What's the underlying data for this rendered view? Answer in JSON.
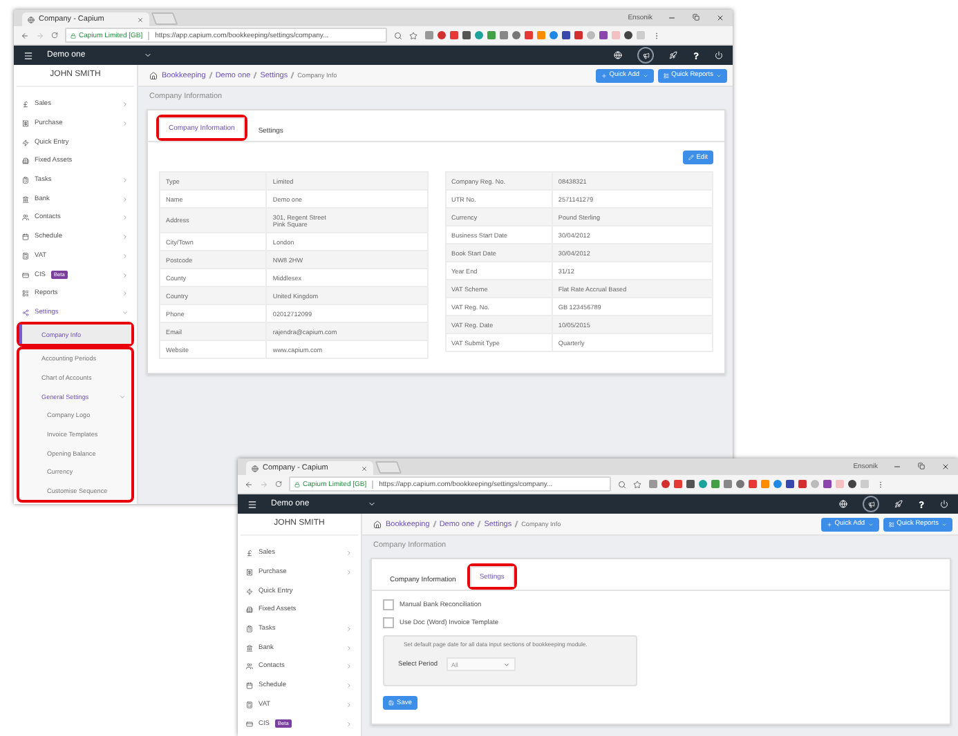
{
  "windows": [
    {
      "tab_title": "Company - Capium",
      "profile": "Ensonik",
      "site_label": "Capium Limited [GB]",
      "url": "https://app.capium.com/bookkeeping/settings/company...",
      "company": "Demo one",
      "user": "JOHN SMITH",
      "breadcrumbs": [
        "Bookkeeping",
        "Demo one",
        "Settings"
      ],
      "current": "Company Info",
      "quick_add": "Quick Add",
      "quick_reports": "Quick Reports",
      "page_title": "Company Information",
      "sidebar": [
        {
          "label": "Sales",
          "submenu": true,
          "expanded": false
        },
        {
          "label": "Purchase",
          "submenu": true,
          "expanded": false
        },
        {
          "label": "Quick Entry",
          "submenu": false,
          "expanded": false
        },
        {
          "label": "Fixed Assets",
          "submenu": false,
          "expanded": false
        },
        {
          "label": "Tasks",
          "submenu": true,
          "expanded": false
        },
        {
          "label": "Bank",
          "submenu": true,
          "expanded": false
        },
        {
          "label": "Contacts",
          "submenu": true,
          "expanded": false
        },
        {
          "label": "Schedule",
          "submenu": true,
          "expanded": false
        },
        {
          "label": "VAT",
          "submenu": true,
          "expanded": false
        },
        {
          "label": "CIS",
          "badge": "Beta",
          "submenu": true,
          "expanded": false
        },
        {
          "label": "Reports",
          "submenu": true,
          "expanded": false
        },
        {
          "label": "Settings",
          "submenu": true,
          "expanded": true,
          "children": [
            {
              "label": "Company Info",
              "selected": true,
              "highlighted": true
            },
            {
              "label": "Accounting Periods",
              "selected": false,
              "highlighted": true
            },
            {
              "label": "Chart of Accounts",
              "selected": false,
              "highlighted": true
            },
            {
              "label": "General Settings",
              "selected": false,
              "highlighted": true,
              "expanded": true,
              "children": [
                {
                  "label": "Company Logo",
                  "selected": false
                },
                {
                  "label": "Invoice Templates",
                  "selected": false
                },
                {
                  "label": "Opening Balance",
                  "selected": false
                },
                {
                  "label": "Currency",
                  "selected": false
                },
                {
                  "label": "Customise Sequence",
                  "selected": false
                }
              ]
            }
          ]
        }
      ],
      "tabs": [
        {
          "label": "Company Information",
          "selected": true,
          "highlighted": true
        },
        {
          "label": "Settings",
          "selected": false,
          "highlighted": false
        }
      ],
      "panel": {
        "kind": "info",
        "edit": "Edit",
        "left_rows": [
          {
            "label": "Type",
            "value": "Limited"
          },
          {
            "label": "Name",
            "value": "Demo one"
          },
          {
            "label": "Address",
            "value": "301, Regent Street\nPink Square"
          },
          {
            "label": "City/Town",
            "value": "London"
          },
          {
            "label": "Postcode",
            "value": "NW8 2HW"
          },
          {
            "label": "County",
            "value": "Middlesex"
          },
          {
            "label": "Country",
            "value": "United Kingdom"
          },
          {
            "label": "Phone",
            "value": "02012712099"
          },
          {
            "label": "Email",
            "value": "rajendra@capium.com"
          },
          {
            "label": "Website",
            "value": "www.capium.com"
          }
        ],
        "right_rows": [
          {
            "label": "Company Reg. No.",
            "value": "08438321"
          },
          {
            "label": "UTR No.",
            "value": "2571141279"
          },
          {
            "label": "Currency",
            "value": "Pound Sterling"
          },
          {
            "label": "Business Start Date",
            "value": "30/04/2012"
          },
          {
            "label": "Book Start Date",
            "value": "30/04/2012"
          },
          {
            "label": "Year End",
            "value": "31/12"
          },
          {
            "label": "VAT Scheme",
            "value": "Flat Rate Accrual Based"
          },
          {
            "label": "VAT Reg. No.",
            "value": "GB 123456789"
          },
          {
            "label": "VAT Reg. Date",
            "value": "10/05/2015"
          },
          {
            "label": "VAT Submit Type",
            "value": "Quarterly"
          }
        ]
      }
    },
    {
      "tab_title": "Company - Capium",
      "profile": "Ensonik",
      "site_label": "Capium Limited [GB]",
      "url": "https://app.capium.com/bookkeeping/settings/company...",
      "company": "Demo one",
      "user": "JOHN SMITH",
      "breadcrumbs": [
        "Bookkeeping",
        "Demo one",
        "Settings"
      ],
      "current": "Company Info",
      "quick_add": "Quick Add",
      "quick_reports": "Quick Reports",
      "page_title": "Company Information",
      "sidebar": [
        {
          "label": "Sales",
          "submenu": true,
          "expanded": false
        },
        {
          "label": "Purchase",
          "submenu": true,
          "expanded": false
        },
        {
          "label": "Quick Entry",
          "submenu": false,
          "expanded": false
        },
        {
          "label": "Fixed Assets",
          "submenu": false,
          "expanded": false
        },
        {
          "label": "Tasks",
          "submenu": true,
          "expanded": false
        },
        {
          "label": "Bank",
          "submenu": true,
          "expanded": false
        },
        {
          "label": "Contacts",
          "submenu": true,
          "expanded": false
        },
        {
          "label": "Schedule",
          "submenu": true,
          "expanded": false
        },
        {
          "label": "VAT",
          "submenu": true,
          "expanded": false
        },
        {
          "label": "CIS",
          "badge": "Beta",
          "submenu": true,
          "expanded": false
        }
      ],
      "tabs": [
        {
          "label": "Company Information",
          "selected": false,
          "highlighted": false
        },
        {
          "label": "Settings",
          "selected": true,
          "highlighted": true
        }
      ],
      "panel": {
        "kind": "settings",
        "checkboxes": [
          {
            "label": "Manual Bank Reconciliation",
            "checked": false
          },
          {
            "label": "Use Doc (Word) Invoice Template",
            "checked": false
          }
        ],
        "note": "Set default page date for all data input sections of bookkeeping module.",
        "select_label": "Select Period",
        "select_value": "All",
        "save": "Save"
      }
    }
  ]
}
